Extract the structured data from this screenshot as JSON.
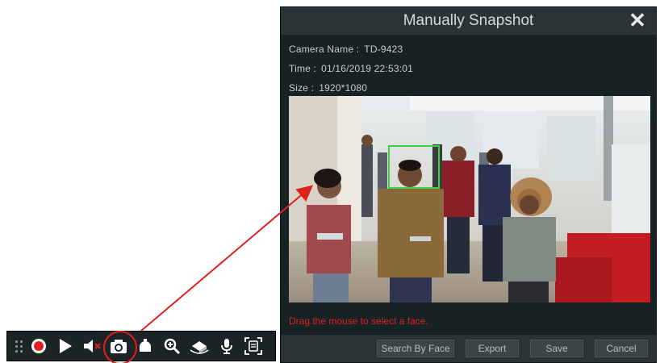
{
  "dialog": {
    "title": "Manually Snapshot",
    "close_glyph": "✕",
    "camera_label": "Camera Name :",
    "camera_value": "TD-9423",
    "time_label": "Time :",
    "time_value": "01/16/2019 22:53:01",
    "size_label": "Size :",
    "size_value": "1920*1080",
    "hint": "Drag the mouse to select a face.",
    "buttons": {
      "search_by_face": "Search By Face",
      "export": "Export",
      "save": "Save",
      "cancel": "Cancel"
    }
  },
  "toolbar": {
    "icons": [
      "grip-icon",
      "record-icon",
      "play-icon",
      "mute-icon",
      "snapshot-icon",
      "ptz-icon",
      "zoom-in-icon",
      "3d-rotate-icon",
      "microphone-icon",
      "face-capture-icon"
    ],
    "highlighted": "snapshot-icon"
  },
  "colors": {
    "highlight": "#e02020",
    "arrow": "#e02020",
    "face_box": "#3fd23f",
    "dialog_bg": "#172224",
    "toolbar_bg": "#1c2426"
  }
}
